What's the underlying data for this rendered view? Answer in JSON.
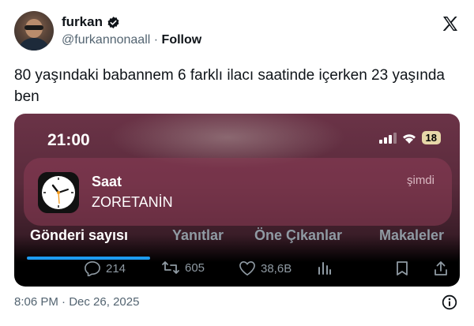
{
  "user": {
    "display_name": "furkan",
    "handle": "@furkannonaall",
    "separator": "·",
    "follow_label": "Follow"
  },
  "tweet": {
    "text": "80 yaşındaki babannem 6 farklı ilacı saatinde içerken 23 yaşında ben"
  },
  "media": {
    "status_time": "21:00",
    "battery": "18",
    "notification": {
      "app": "Saat",
      "body": "ZORETANİN",
      "time": "şimdi"
    },
    "tabs": [
      "Gönderi sayısı",
      "Yanıtlar",
      "Öne Çıkanlar",
      "Makaleler"
    ],
    "counts": {
      "replies": "214",
      "reposts": "605",
      "likes": "38,6B"
    }
  },
  "footer": {
    "time": "8:06 PM",
    "separator": "·",
    "date": "Dec 26, 2025"
  },
  "colors": {
    "accent": "#1d9bf0",
    "text": "#0f1419",
    "muted": "#536471"
  }
}
